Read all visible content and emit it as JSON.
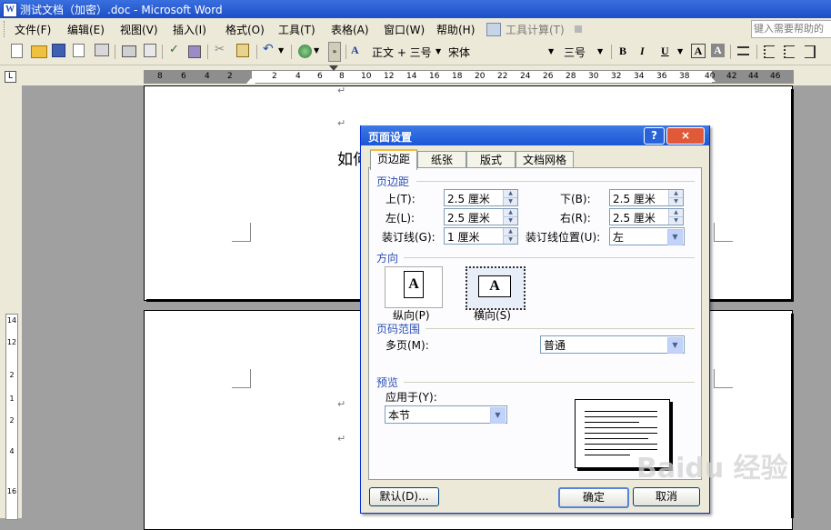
{
  "window": {
    "title": "测试文档（加密）.doc - Microsoft Word",
    "app_icon": "W"
  },
  "menubar": {
    "items": [
      "文件(F)",
      "编辑(E)",
      "视图(V)",
      "插入(I)",
      "格式(O)",
      "工具(T)",
      "表格(A)",
      "窗口(W)",
      "帮助(H)",
      "工具计算(T)"
    ],
    "help_placeholder": "键入需要帮助的"
  },
  "toolbar": {
    "style": "正文 + 三号",
    "font": "宋体",
    "size": "三号",
    "bold": "B",
    "italic": "I",
    "underline": "U",
    "font_color": "A",
    "highlight": "A"
  },
  "ruler": {
    "tab_selector": "L",
    "numbers": [
      "8",
      "6",
      "4",
      "2",
      "",
      "2",
      "4",
      "6",
      "8",
      "10",
      "12",
      "14",
      "16",
      "18",
      "20",
      "22",
      "24",
      "26",
      "28",
      "30",
      "32",
      "34",
      "36",
      "38",
      "40",
      "42",
      "44",
      "46"
    ],
    "vertical_numbers": [
      "14",
      "12",
      "2",
      "1",
      "2",
      "4",
      "16"
    ]
  },
  "document": {
    "partial_text": "如何"
  },
  "dialog": {
    "title": "页面设置",
    "help_btn": "?",
    "close_btn": "×",
    "tabs": [
      "页边距",
      "纸张",
      "版式",
      "文档网格"
    ],
    "margins": {
      "group": "页边距",
      "top_label": "上(T):",
      "top_value": "2.5 厘米",
      "bottom_label": "下(B):",
      "bottom_value": "2.5 厘米",
      "left_label": "左(L):",
      "left_value": "2.5 厘米",
      "right_label": "右(R):",
      "right_value": "2.5 厘米",
      "gutter_label": "装订线(G):",
      "gutter_value": "1 厘米",
      "gutter_pos_label": "装订线位置(U):",
      "gutter_pos_value": "左"
    },
    "orientation": {
      "group": "方向",
      "portrait": "纵向(P)",
      "landscape": "横向(S)",
      "glyph": "A"
    },
    "pages": {
      "group": "页码范围",
      "multi_label": "多页(M):",
      "multi_value": "普通"
    },
    "preview": {
      "group": "预览",
      "apply_label": "应用于(Y):",
      "apply_value": "本节"
    },
    "buttons": {
      "default": "默认(D)...",
      "ok": "确定",
      "cancel": "取消"
    }
  },
  "watermark": "Baidu 经验",
  "colors": {
    "titlebar": "#1c4fc4",
    "dialog_title": "#1b56d6",
    "chrome": "#ece9d8",
    "tab_accent": "#f7b73a"
  }
}
